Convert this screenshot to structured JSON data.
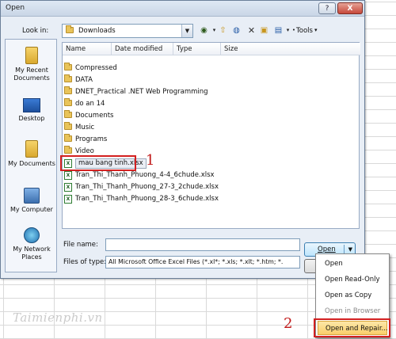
{
  "dialog": {
    "title": "Open",
    "help": "?",
    "close": "X",
    "look_in_label": "Look in:",
    "look_in_value": "Downloads",
    "tools_label": "Tools"
  },
  "places": [
    {
      "label": "My Recent Documents"
    },
    {
      "label": "Desktop"
    },
    {
      "label": "My Documents"
    },
    {
      "label": "My Computer"
    },
    {
      "label": "My Network Places"
    }
  ],
  "columns": [
    "Name",
    "Date modified",
    "Type",
    "Size"
  ],
  "folders": [
    "Compressed",
    "DATA",
    "DNET_Practical .NET Web Programming",
    "do an 14",
    "Documents",
    "Music",
    "Programs",
    "Video"
  ],
  "files": [
    "mau bang tinh.xlsx",
    "Tran_Thi_Thanh_Phuong_4-4_6chude.xlsx",
    "Tran_Thi_Thanh_Phuong_27-3_2chude.xlsx",
    "Tran_Thi_Thanh_Phuong_28-3_6chude.xlsx"
  ],
  "file_name_label": "File name:",
  "file_name_value": "",
  "files_of_type_label": "Files of type:",
  "files_of_type_value": "All Microsoft Office Excel Files (*.xl*; *.xls; *.xlt; *.htm; *.",
  "open_button": "Open",
  "menu": [
    "Open",
    "Open Read-Only",
    "Open as Copy",
    "Open in Browser",
    "Open and Repair..."
  ],
  "annotations": {
    "step1": "1",
    "step2": "2"
  },
  "watermark": "Taimienphi.vn",
  "colors": {
    "highlight": "#f9cf6a",
    "annotation": "#d32020",
    "folder": "#e9c45a"
  }
}
